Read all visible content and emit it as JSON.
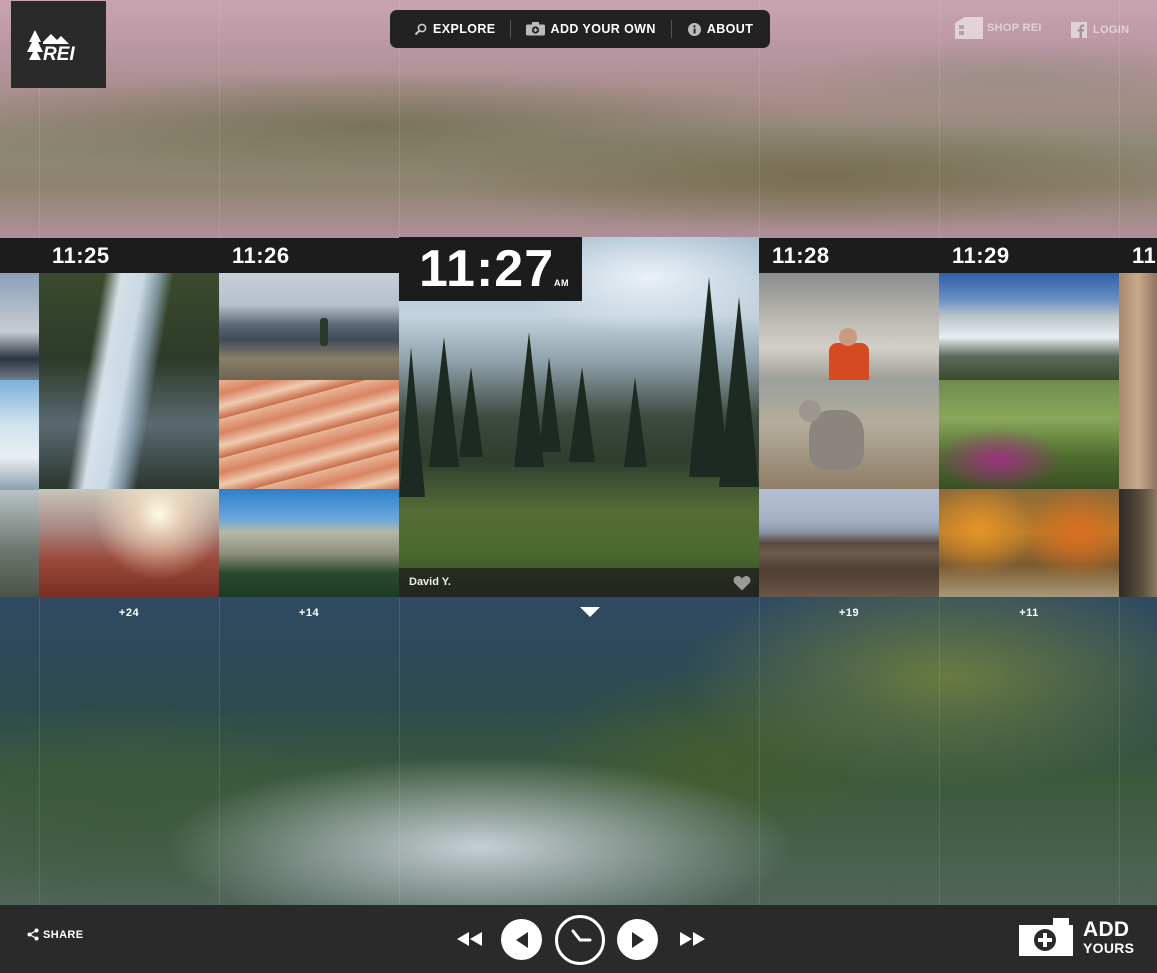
{
  "nav": {
    "explore": "EXPLORE",
    "add_your_own": "ADD YOUR OWN",
    "about": "ABOUT",
    "shop": "SHOP REI",
    "login": "LOGIN",
    "logo_text": "REI"
  },
  "timeline": {
    "columns": [
      {
        "time": "11:25",
        "count": "+24"
      },
      {
        "time": "11:26",
        "count": "+14"
      },
      {
        "time": "11:28",
        "count": "+19"
      },
      {
        "time": "11:29",
        "count": "+11"
      },
      {
        "time": "11"
      }
    ],
    "featured": {
      "time": "11:27",
      "ampm": "AM",
      "author": "David Y."
    }
  },
  "footer": {
    "share": "SHARE",
    "add": "ADD",
    "yours": "YOURS"
  },
  "colors": {
    "bar": "#2b2a2a",
    "timebar": "#1c1c1c",
    "nav_bg": "#222222"
  }
}
